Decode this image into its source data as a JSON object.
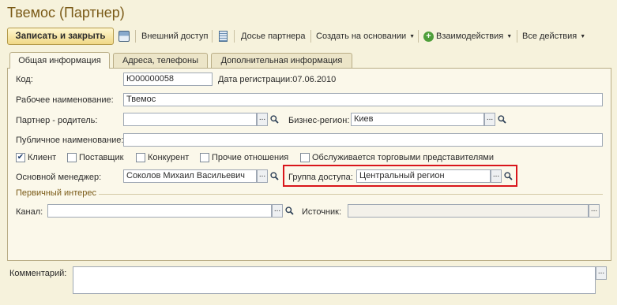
{
  "window": {
    "title": "Твемос (Партнер)"
  },
  "toolbar": {
    "save_close_label": "Записать и закрыть",
    "external_access_label": "Внешний доступ",
    "dossier_label": "Досье партнера",
    "create_based_label": "Создать на основании",
    "interactions_label": "Взаимодействия",
    "all_actions_label": "Все действия"
  },
  "tabs": [
    {
      "label": "Общая информация"
    },
    {
      "label": "Адреса, телефоны"
    },
    {
      "label": "Дополнительная информация"
    }
  ],
  "form": {
    "code_label": "Код:",
    "code_value": "Ю00000058",
    "reg_date_label": "Дата регистрации:",
    "reg_date_value": "07.06.2010",
    "work_name_label": "Рабочее наименование:",
    "work_name_value": "Твемос",
    "parent_label": "Партнер - родитель:",
    "parent_value": "",
    "region_label": "Бизнес-регион:",
    "region_value": "Киев",
    "public_name_label": "Публичное наименование:",
    "public_name_value": "",
    "checkboxes": [
      {
        "label": "Клиент",
        "checked": true
      },
      {
        "label": "Поставщик",
        "checked": false
      },
      {
        "label": "Конкурент",
        "checked": false
      },
      {
        "label": "Прочие отношения",
        "checked": false
      },
      {
        "label": "Обслуживается торговыми представителями",
        "checked": false
      }
    ],
    "manager_label": "Основной менеджер:",
    "manager_value": "Соколов Михаил Васильевич",
    "access_group_label": "Группа доступа:",
    "access_group_value": "Центральный регион",
    "primary_interest_label": "Первичный интерес",
    "channel_label": "Канал:",
    "channel_value": "",
    "source_label": "Источник:",
    "source_value": "",
    "comment_label": "Комментарий:",
    "comment_value": ""
  },
  "colors": {
    "background": "#f6f2dc",
    "title": "#7a5a17",
    "highlight_border": "#d9151b"
  },
  "icons": {
    "save": "floppy-disk-icon",
    "dossier": "document-icon",
    "interactions": "plus-circle-icon",
    "select": "ellipsis-icon",
    "open": "magnifier-icon"
  }
}
